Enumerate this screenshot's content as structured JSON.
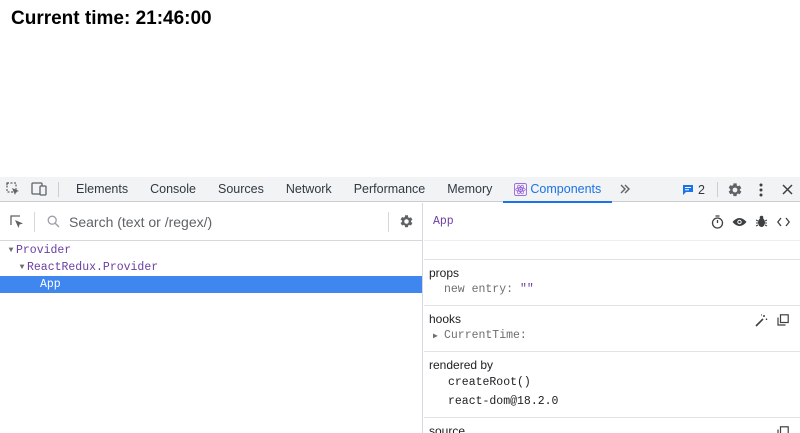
{
  "page": {
    "heading": "Current time: 21:46:00"
  },
  "devtools": {
    "tabs": [
      {
        "label": "Elements"
      },
      {
        "label": "Console"
      },
      {
        "label": "Sources"
      },
      {
        "label": "Network"
      },
      {
        "label": "Performance"
      },
      {
        "label": "Memory"
      },
      {
        "label": "Components",
        "active": true
      }
    ],
    "issues_count": "2",
    "accent_color": "#1a73e8",
    "icons": {
      "inspect": "inspect-element-icon",
      "device": "device-toolbar-icon",
      "more_tabs": "double-chevron-right-icon",
      "issues": "issues-chat-icon",
      "settings": "gear-icon",
      "menu": "kebab-menu-icon",
      "close": "close-icon"
    }
  },
  "components": {
    "search": {
      "placeholder": "Search (text or /regex/)"
    },
    "tree": [
      {
        "label": "Provider",
        "depth": 0,
        "expanded": true,
        "selected": false
      },
      {
        "label": "ReactRedux.Provider",
        "depth": 1,
        "expanded": true,
        "selected": false
      },
      {
        "label": "App",
        "depth": 2,
        "selected": true
      }
    ],
    "selection_color": "#3f87ee",
    "inspector": {
      "title": "App",
      "props": {
        "title": "props",
        "items": [
          {
            "key": "new entry",
            "value": "\"\""
          }
        ]
      },
      "hooks": {
        "title": "hooks",
        "items": [
          {
            "label": "CurrentTime:"
          }
        ]
      },
      "rendered_by": {
        "title": "rendered by",
        "items": [
          "createRoot()",
          "react-dom@18.2.0"
        ]
      },
      "source": {
        "title": "source"
      }
    }
  }
}
